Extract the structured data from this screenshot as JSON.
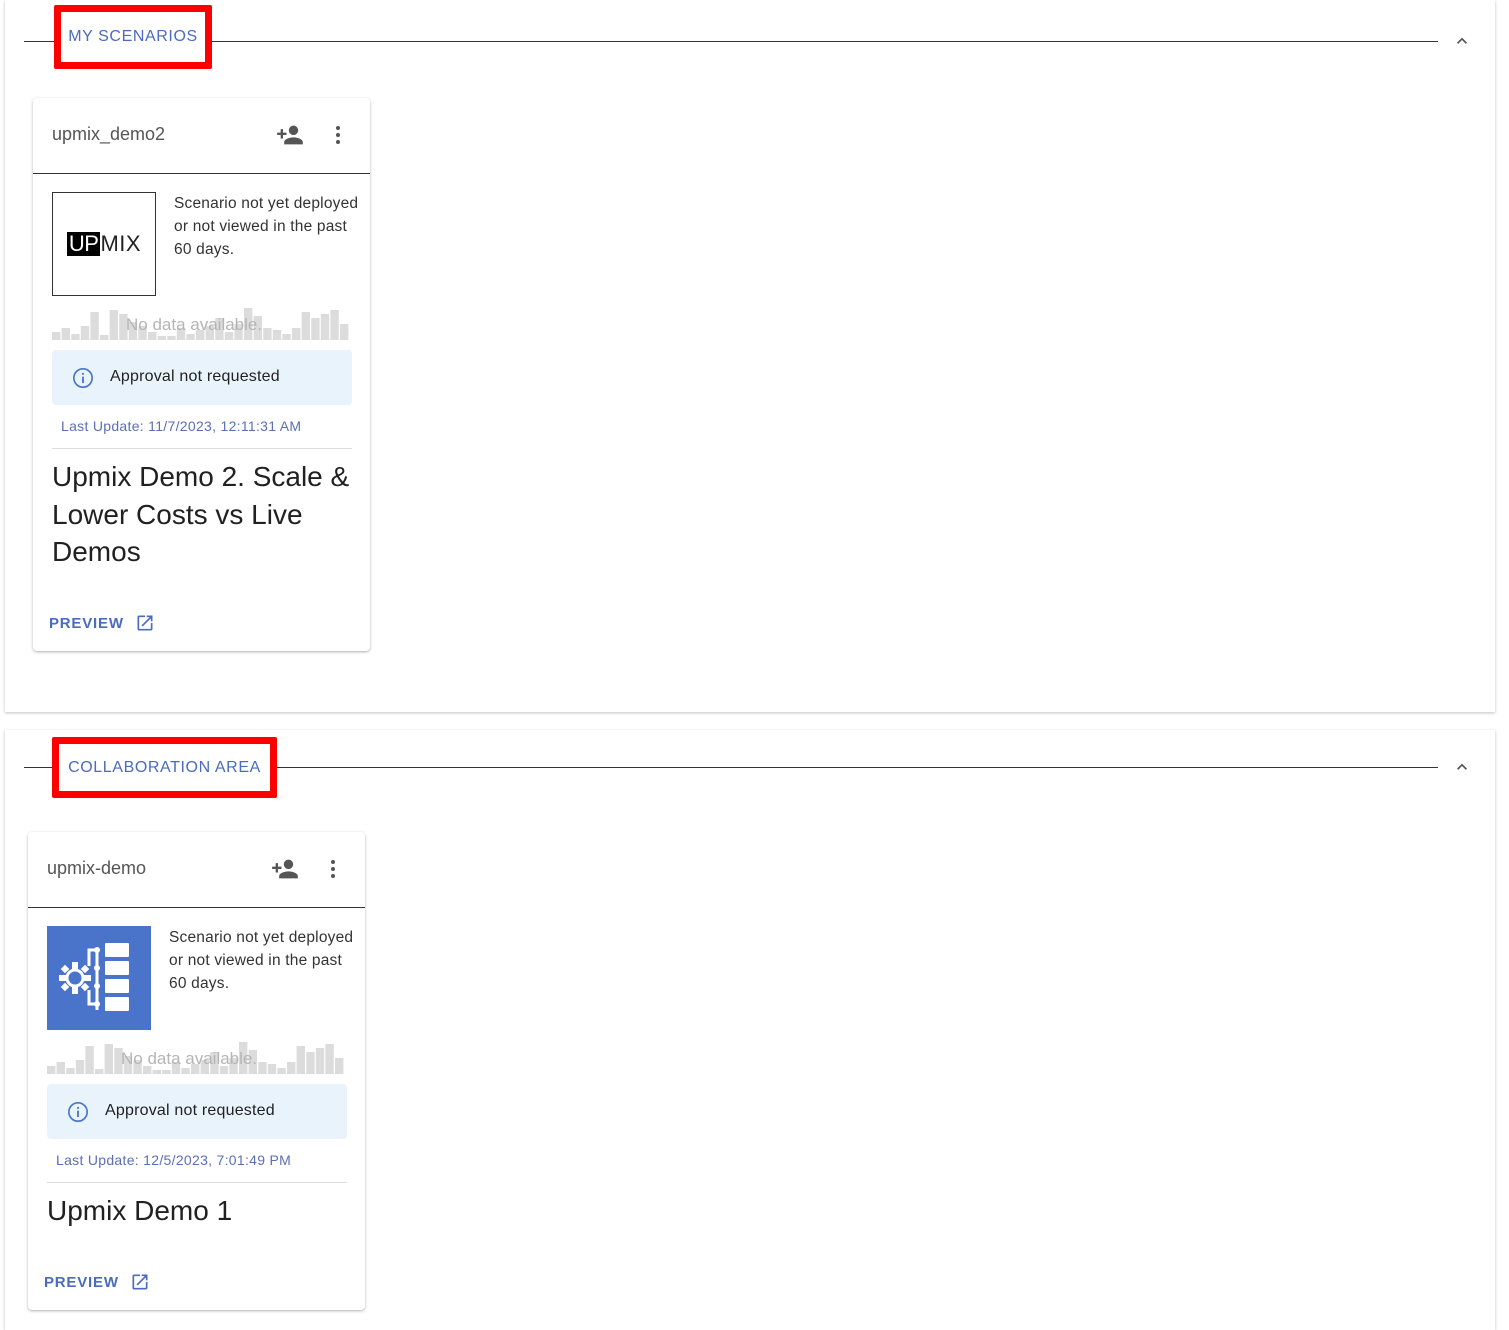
{
  "sections": [
    {
      "title": "MY SCENARIOS",
      "cards": [
        {
          "name": "upmix_demo2",
          "thumb": "upmix-logo",
          "logo": {
            "up": "UP",
            "mix": "MIX"
          },
          "status": "Scenario not yet deployed or not viewed in the past 60 days.",
          "chart_msg": "No data available.",
          "approval": "Approval not requested",
          "last_update": "Last Update: 11/7/2023, 12:11:31 AM",
          "title": "Upmix Demo 2. Scale & Lower Costs vs Live Demos",
          "preview": "PREVIEW"
        }
      ]
    },
    {
      "title": "COLLABORATION AREA",
      "cards": [
        {
          "name": "upmix-demo",
          "thumb": "workflow-icon",
          "status": "Scenario not yet deployed or not viewed in the past 60 days.",
          "chart_msg": "No data available.",
          "approval": "Approval not requested",
          "last_update": "Last Update: 12/5/2023, 7:01:49 PM",
          "title": "Upmix Demo 1",
          "preview": "PREVIEW"
        }
      ]
    }
  ],
  "icons": {
    "add_person": "person-add-icon",
    "more": "more-vert-icon",
    "info": "info-icon",
    "open": "open-in-new-icon",
    "collapse": "chevron-up-icon"
  },
  "colors": {
    "accent": "#4a6bbf",
    "highlight_border": "#ff0000",
    "approval_bg": "#e8f3fc",
    "thumb_blue": "#4a74c9"
  }
}
